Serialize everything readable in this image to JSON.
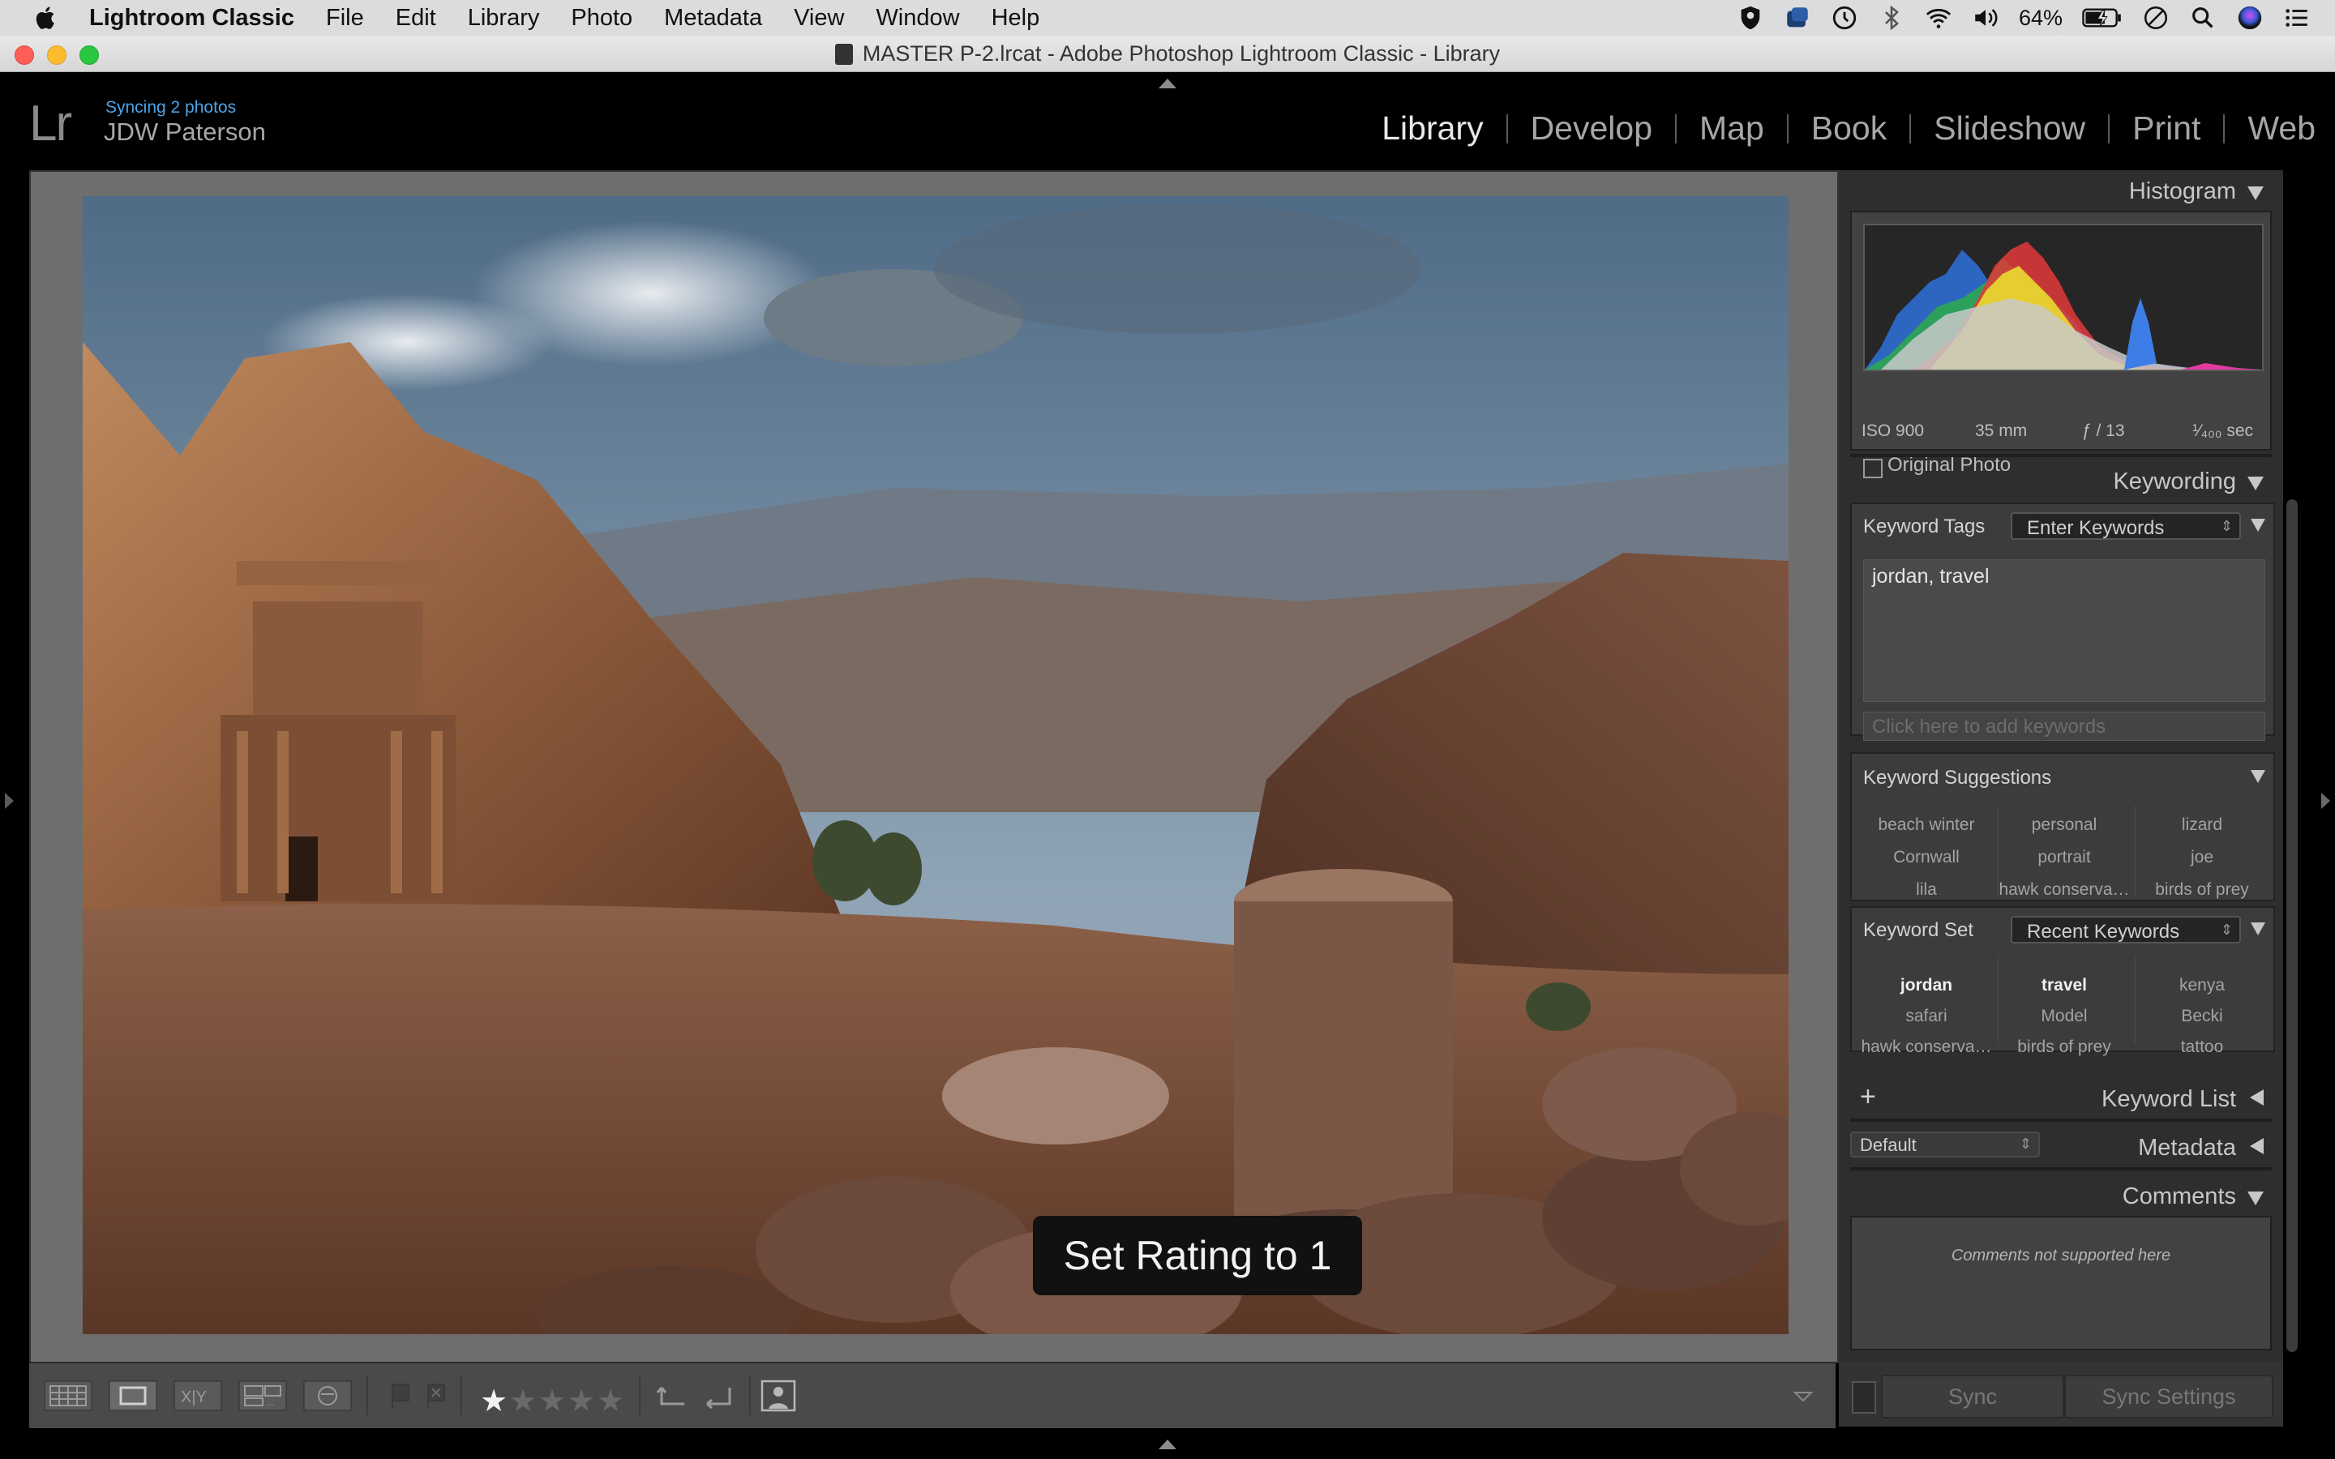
{
  "menubar": {
    "app_name": "Lightroom Classic",
    "items": [
      "File",
      "Edit",
      "Library",
      "Photo",
      "Metadata",
      "View",
      "Window",
      "Help"
    ],
    "battery": "64%",
    "icons": [
      "vpn-shield-icon",
      "cloud-sync-icon",
      "time-machine-icon",
      "bluetooth-icon",
      "wifi-icon",
      "volume-icon",
      "battery-charging-icon",
      "screen-time-icon",
      "spotlight-search-icon",
      "siri-icon",
      "notification-center-icon"
    ]
  },
  "window": {
    "title": "MASTER P-2.lrcat - Adobe Photoshop Lightroom Classic - Library"
  },
  "identity": {
    "sync_status": "Syncing 2 photos",
    "user_name": "JDW Paterson",
    "logo": "Lr"
  },
  "modules": [
    "Library",
    "Develop",
    "Map",
    "Book",
    "Slideshow",
    "Print",
    "Web"
  ],
  "active_module": "Library",
  "hud": {
    "message": "Set Rating to 1"
  },
  "toolbar": {
    "rating": 1,
    "max_rating": 5,
    "icons": [
      "grid-view-icon",
      "loupe-view-icon",
      "compare-view-icon",
      "survey-view-icon",
      "people-view-icon",
      "pick-flag-icon",
      "reject-flag-icon",
      "rotate-left-icon",
      "rotate-right-icon",
      "face-region-icon",
      "toolbar-menu-icon"
    ]
  },
  "histogram": {
    "title": "Histogram",
    "iso": "ISO 900",
    "focal": "35 mm",
    "aperture": "ƒ / 13",
    "shutter": "¹⁄₄₀₀ sec",
    "original_photo_label": "Original Photo"
  },
  "keywording": {
    "title": "Keywording",
    "keyword_tags_label": "Keyword Tags",
    "keyword_tags_mode": "Enter Keywords",
    "keywords_text": "jordan, travel",
    "add_placeholder": "Click here to add keywords",
    "suggestions_label": "Keyword Suggestions",
    "suggestions": [
      "beach winter",
      "personal",
      "lizard",
      "Cornwall",
      "portrait",
      "joe",
      "lila",
      "hawk conserva…",
      "birds of prey"
    ],
    "keyword_set_label": "Keyword Set",
    "keyword_set_value": "Recent Keywords",
    "keyword_set": [
      "jordan",
      "travel",
      "kenya",
      "safari",
      "Model",
      "Becki",
      "hawk conserva…",
      "birds of prey",
      "tattoo"
    ],
    "keyword_set_highlighted": [
      "jordan",
      "travel"
    ]
  },
  "keyword_list": {
    "title": "Keyword List"
  },
  "metadata": {
    "title": "Metadata",
    "preset": "Default"
  },
  "comments": {
    "title": "Comments",
    "note": "Comments not supported here"
  },
  "sync": {
    "sync_label": "Sync",
    "sync_settings_label": "Sync Settings"
  }
}
